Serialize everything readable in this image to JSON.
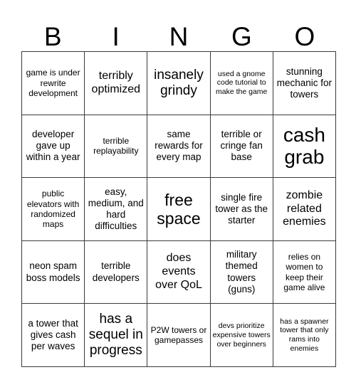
{
  "card": {
    "title": "BINGO",
    "header_letters": [
      "B",
      "I",
      "N",
      "G",
      "O"
    ],
    "columns": 5,
    "rows": 5,
    "colors": {
      "background": "#ffffff",
      "text": "#000000",
      "grid_line": "#3a3a3a"
    },
    "cells": [
      [
        {
          "text": "game is under rewrite development",
          "size": "sm"
        },
        {
          "text": "terribly optimized",
          "size": "lg"
        },
        {
          "text": "insanely grindy",
          "size": "xl"
        },
        {
          "text": "used a gnome code tutorial to make the game",
          "size": "xs"
        },
        {
          "text": "stunning mechanic for towers",
          "size": "md"
        }
      ],
      [
        {
          "text": "developer gave up within a year",
          "size": "md"
        },
        {
          "text": "terrible replayability",
          "size": "sm"
        },
        {
          "text": "same rewards for every map",
          "size": "md"
        },
        {
          "text": "terrible or cringe fan base",
          "size": "md"
        },
        {
          "text": "cash grab",
          "size": "huge"
        }
      ],
      [
        {
          "text": "public elevators with randomized maps",
          "size": "sm"
        },
        {
          "text": "easy, medium, and hard difficulties",
          "size": "md"
        },
        {
          "text": "free space",
          "size": "xxl"
        },
        {
          "text": "single fire tower as the starter",
          "size": "md"
        },
        {
          "text": "zombie related enemies",
          "size": "lg"
        }
      ],
      [
        {
          "text": "neon spam boss models",
          "size": "md"
        },
        {
          "text": "terrible developers",
          "size": "md"
        },
        {
          "text": "does events over QoL",
          "size": "lg"
        },
        {
          "text": "military themed towers (guns)",
          "size": "md"
        },
        {
          "text": "relies on women to keep their game alive",
          "size": "sm"
        }
      ],
      [
        {
          "text": "a tower that gives cash per waves",
          "size": "md"
        },
        {
          "text": "has a sequel in progress",
          "size": "xl"
        },
        {
          "text": "P2W towers or gamepasses",
          "size": "sm"
        },
        {
          "text": "devs prioritize expensive towers over beginners",
          "size": "xs"
        },
        {
          "text": "has a spawner tower that only rams into enemies",
          "size": "xs"
        }
      ]
    ]
  }
}
